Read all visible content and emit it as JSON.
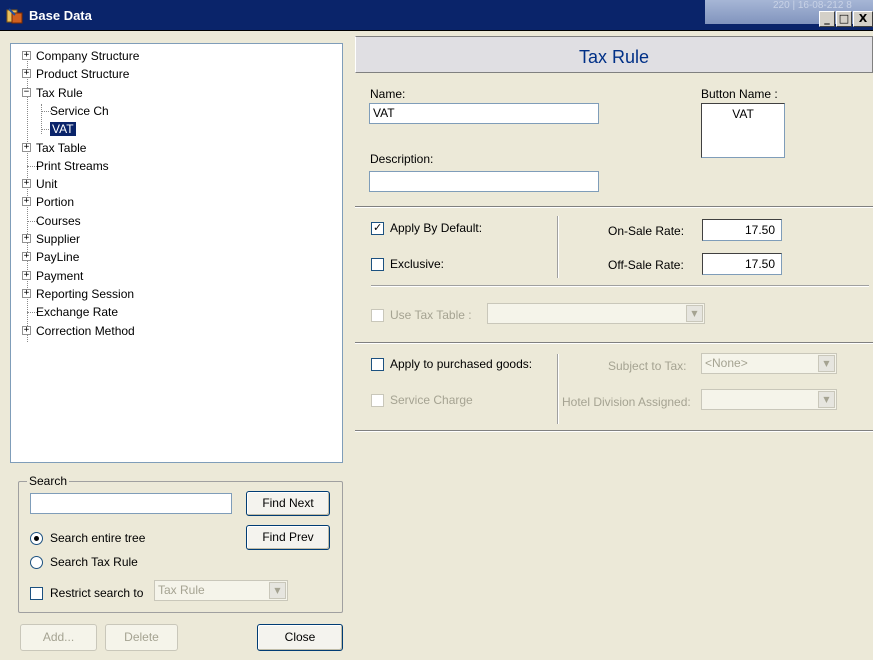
{
  "window": {
    "title": "Base Data",
    "ghost_text": "220 | 16-08-212 8",
    "controls": {
      "minimize": "_",
      "maximize": "□",
      "close": "X"
    }
  },
  "tree": {
    "items": [
      {
        "label": "Company Structure",
        "expander": "+"
      },
      {
        "label": "Product Structure",
        "expander": "+"
      },
      {
        "label": "Tax Rule",
        "expander": "−"
      },
      {
        "label": "Service Ch",
        "expander": ""
      },
      {
        "label": "VAT",
        "expander": "",
        "selected": true
      },
      {
        "label": "Tax Table",
        "expander": "+"
      },
      {
        "label": "Print Streams",
        "expander": ""
      },
      {
        "label": "Unit",
        "expander": "+"
      },
      {
        "label": "Portion",
        "expander": "+"
      },
      {
        "label": "Courses",
        "expander": ""
      },
      {
        "label": "Supplier",
        "expander": "+"
      },
      {
        "label": "PayLine",
        "expander": "+"
      },
      {
        "label": "Payment",
        "expander": "+"
      },
      {
        "label": "Reporting Session",
        "expander": "+"
      },
      {
        "label": "Exchange Rate",
        "expander": ""
      },
      {
        "label": "Correction Method",
        "expander": "+"
      }
    ]
  },
  "search": {
    "legend": "Search",
    "input_value": "",
    "find_next": "Find Next",
    "find_prev": "Find Prev",
    "radio_entire": "Search entire tree",
    "radio_rule": "Search Tax Rule",
    "restrict_label": "Restrict search to",
    "restrict_value": "Tax Rule"
  },
  "bottom_buttons": {
    "add": "Add...",
    "delete": "Delete",
    "close": "Close"
  },
  "panel": {
    "title": "Tax Rule",
    "name_label": "Name:",
    "name_value": "VAT",
    "description_label": "Description:",
    "description_value": "",
    "button_name_label": "Button Name :",
    "button_name_value": "VAT",
    "apply_by_default": "Apply By Default:",
    "exclusive": "Exclusive:",
    "on_sale_label": "On-Sale Rate:",
    "on_sale_value": "17.50",
    "off_sale_label": "Off-Sale Rate:",
    "off_sale_value": "17.50",
    "use_tax_table": "Use Tax Table :",
    "apply_purchased": "Apply to purchased goods:",
    "subject_to_tax_label": "Subject to Tax:",
    "subject_to_tax_value": "<None>",
    "service_charge": "Service Charge",
    "hotel_division_label": "Hotel Division Assigned:",
    "hotel_division_value": ""
  },
  "colors": {
    "titlebar": "#0a246a",
    "header_title": "#003087",
    "selection": "#0a246a"
  }
}
